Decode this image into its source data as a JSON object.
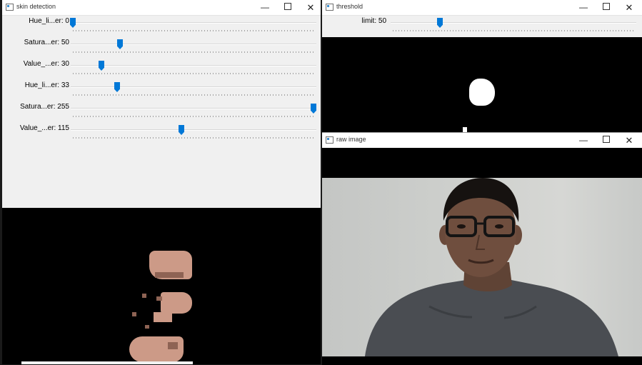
{
  "windows": {
    "skin": {
      "title": "skin detection",
      "trackbars": [
        {
          "label": "Hue_li...er: 0",
          "value": 0
        },
        {
          "label": "Satura...er: 50",
          "value": 50
        },
        {
          "label": "Value_...er: 30",
          "value": 30
        },
        {
          "label": "Hue_li...er: 33",
          "value": 33
        },
        {
          "label": "Satura...er: 255",
          "value": 255
        },
        {
          "label": "Value_...er: 115",
          "value": 115
        }
      ],
      "max": 255
    },
    "threshold": {
      "title": "threshold",
      "trackbars": [
        {
          "label": "limit: 50",
          "value": 50
        }
      ],
      "max": 255
    },
    "raw": {
      "title": "raw image"
    }
  },
  "controls": {
    "minimize_glyph": "—",
    "close_glyph": "✕"
  },
  "colors": {
    "thumb": "#0078d7",
    "titlebar": "#ffffff",
    "panel": "#f0f0f0",
    "canvas": "#000000"
  }
}
